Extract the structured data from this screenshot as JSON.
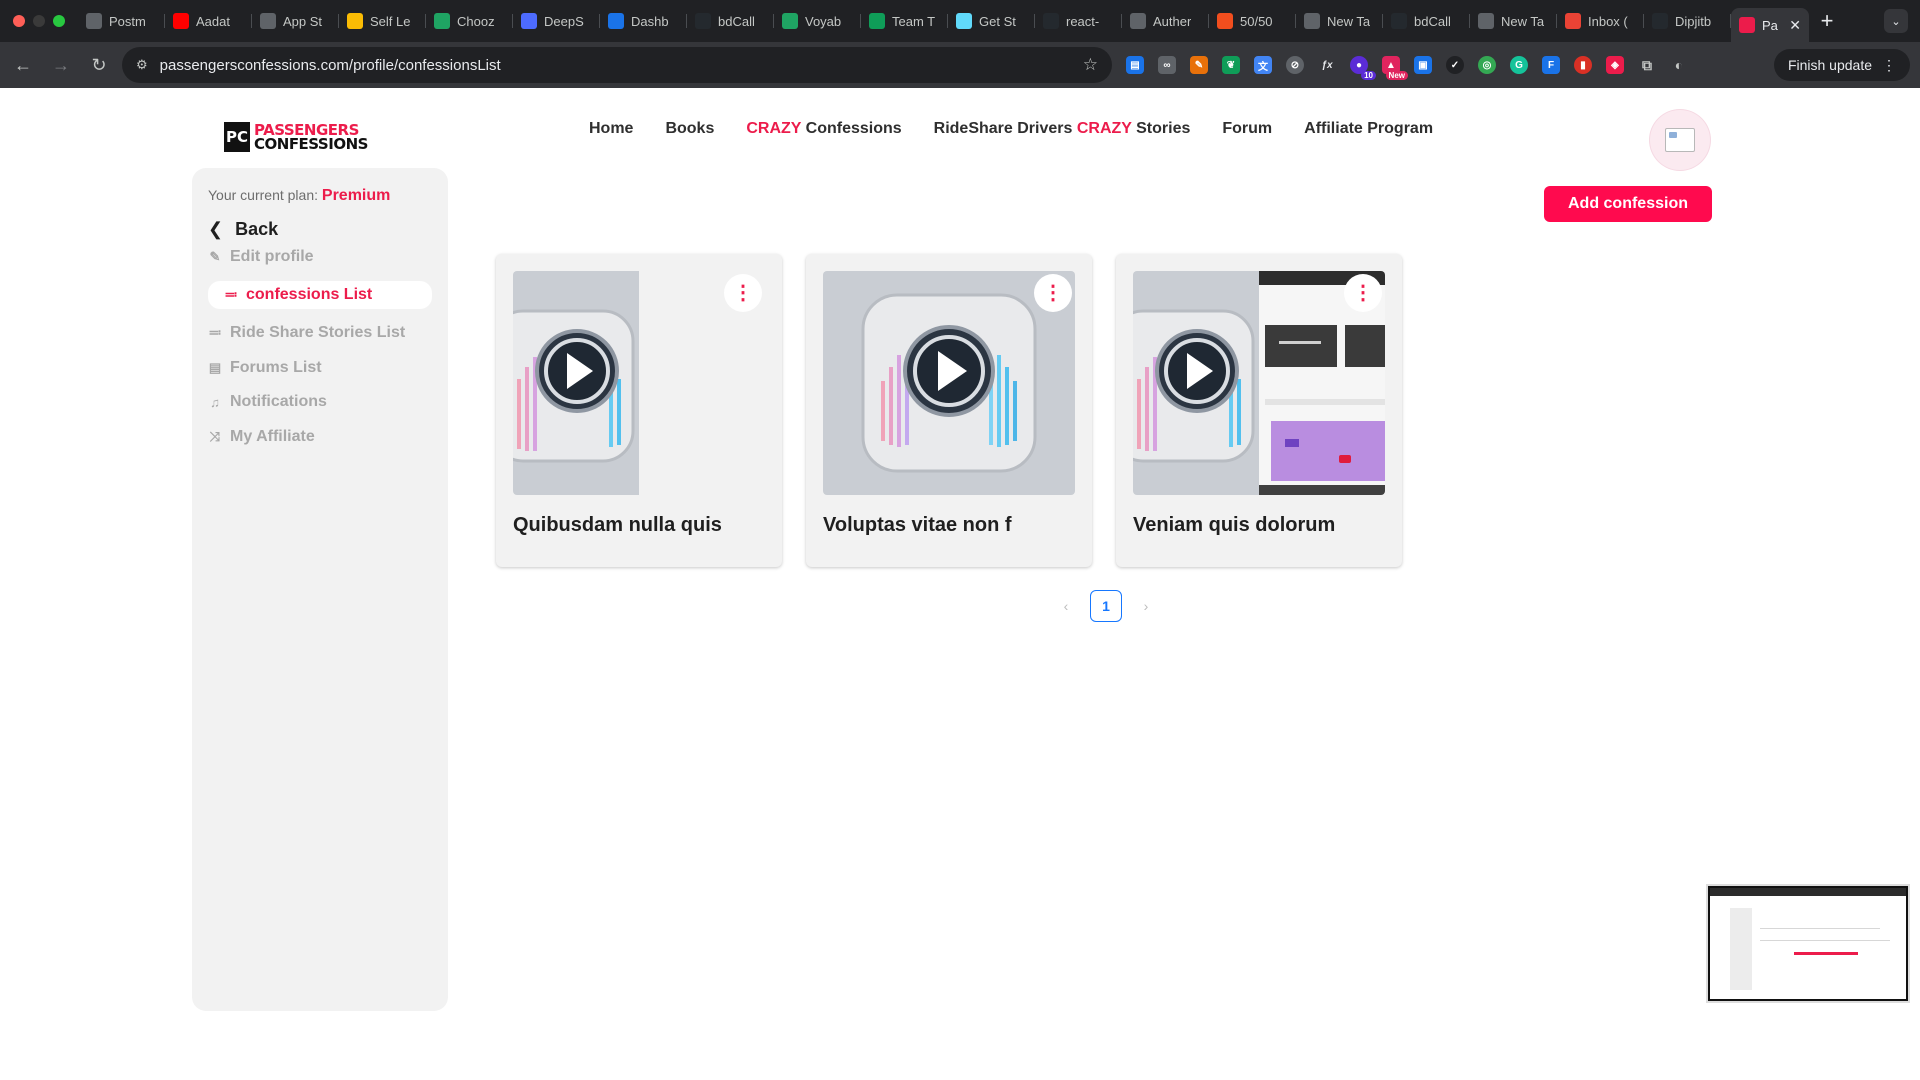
{
  "browser": {
    "tabs": [
      {
        "label": "Postm",
        "icon": "postman-icon",
        "color": "#5f6368"
      },
      {
        "label": "Aadat",
        "icon": "youtube-icon",
        "color": "#ff0000"
      },
      {
        "label": "App St",
        "icon": "apple-icon",
        "color": "#5f6368"
      },
      {
        "label": "Self Le",
        "icon": "slides-icon",
        "color": "#fbbc04"
      },
      {
        "label": "Chooz",
        "icon": "drive-icon",
        "color": "#1fa463"
      },
      {
        "label": "DeepS",
        "icon": "deepseek-icon",
        "color": "#4d6bfe"
      },
      {
        "label": "Dashb",
        "icon": "dashboard-icon",
        "color": "#1a73e8"
      },
      {
        "label": "bdCall",
        "icon": "github-icon",
        "color": "#24292e"
      },
      {
        "label": "Voyab",
        "icon": "drive-icon",
        "color": "#1fa463"
      },
      {
        "label": "Team T",
        "icon": "sheets-icon",
        "color": "#0f9d58"
      },
      {
        "label": "Get St",
        "icon": "react-icon",
        "color": "#61dafb"
      },
      {
        "label": "react-",
        "icon": "github-icon",
        "color": "#24292e"
      },
      {
        "label": "Auther",
        "icon": "openai-icon",
        "color": "#5f6368"
      },
      {
        "label": "50/50",
        "icon": "figma-icon",
        "color": "#f24e1e"
      },
      {
        "label": "New Ta",
        "icon": "chrome-icon",
        "color": "#5f6368"
      },
      {
        "label": "bdCall",
        "icon": "github-icon",
        "color": "#24292e"
      },
      {
        "label": "New Ta",
        "icon": "chrome-icon",
        "color": "#5f6368"
      },
      {
        "label": "Inbox (",
        "icon": "gmail-icon",
        "color": "#ea4335"
      },
      {
        "label": "Dipjitb",
        "icon": "github-icon",
        "color": "#24292e"
      }
    ],
    "active_tab": {
      "label": "Pa",
      "icon": "passengers-icon",
      "color": "#ec1c4b"
    },
    "url": "passengersconfessions.com/profile/confessionsList",
    "finish_update": "Finish update",
    "extension_badges": {
      "ext2": "10",
      "ext3": "New"
    }
  },
  "site": {
    "logo_mark": "PC",
    "logo_line1": "PASSENGERS",
    "logo_line2": "CONFESSIONS",
    "nav": {
      "home": "Home",
      "books": "Books",
      "crazy_hl": "CRAZY",
      "confessions": " Confessions",
      "rideshare_pre": "RideShare Drivers ",
      "rideshare_hl": "CRAZY",
      "rideshare_post": " Stories",
      "forum": "Forum",
      "affiliate": "Affiliate Program"
    },
    "accent_color": "#ec1c4b"
  },
  "sidebar": {
    "plan_label": "Your current plan: ",
    "plan_value": "Premium",
    "back": "Back",
    "items": [
      {
        "label": "Edit profile",
        "icon": "edit-icon"
      },
      {
        "label": "confessions List",
        "icon": "list-icon",
        "active": true
      },
      {
        "label": "Ride Share Stories List",
        "icon": "list-icon"
      },
      {
        "label": "Forums List",
        "icon": "forum-icon"
      },
      {
        "label": "Notifications",
        "icon": "bell-icon"
      },
      {
        "label": "My Affiliate",
        "icon": "affiliate-icon"
      }
    ]
  },
  "main": {
    "add_button": "Add confession",
    "cards": [
      {
        "title": "Quibusdam nulla quis"
      },
      {
        "title": "Voluptas vitae non f"
      },
      {
        "title": "Veniam quis dolorum"
      }
    ],
    "pagination": {
      "current": "1"
    }
  }
}
